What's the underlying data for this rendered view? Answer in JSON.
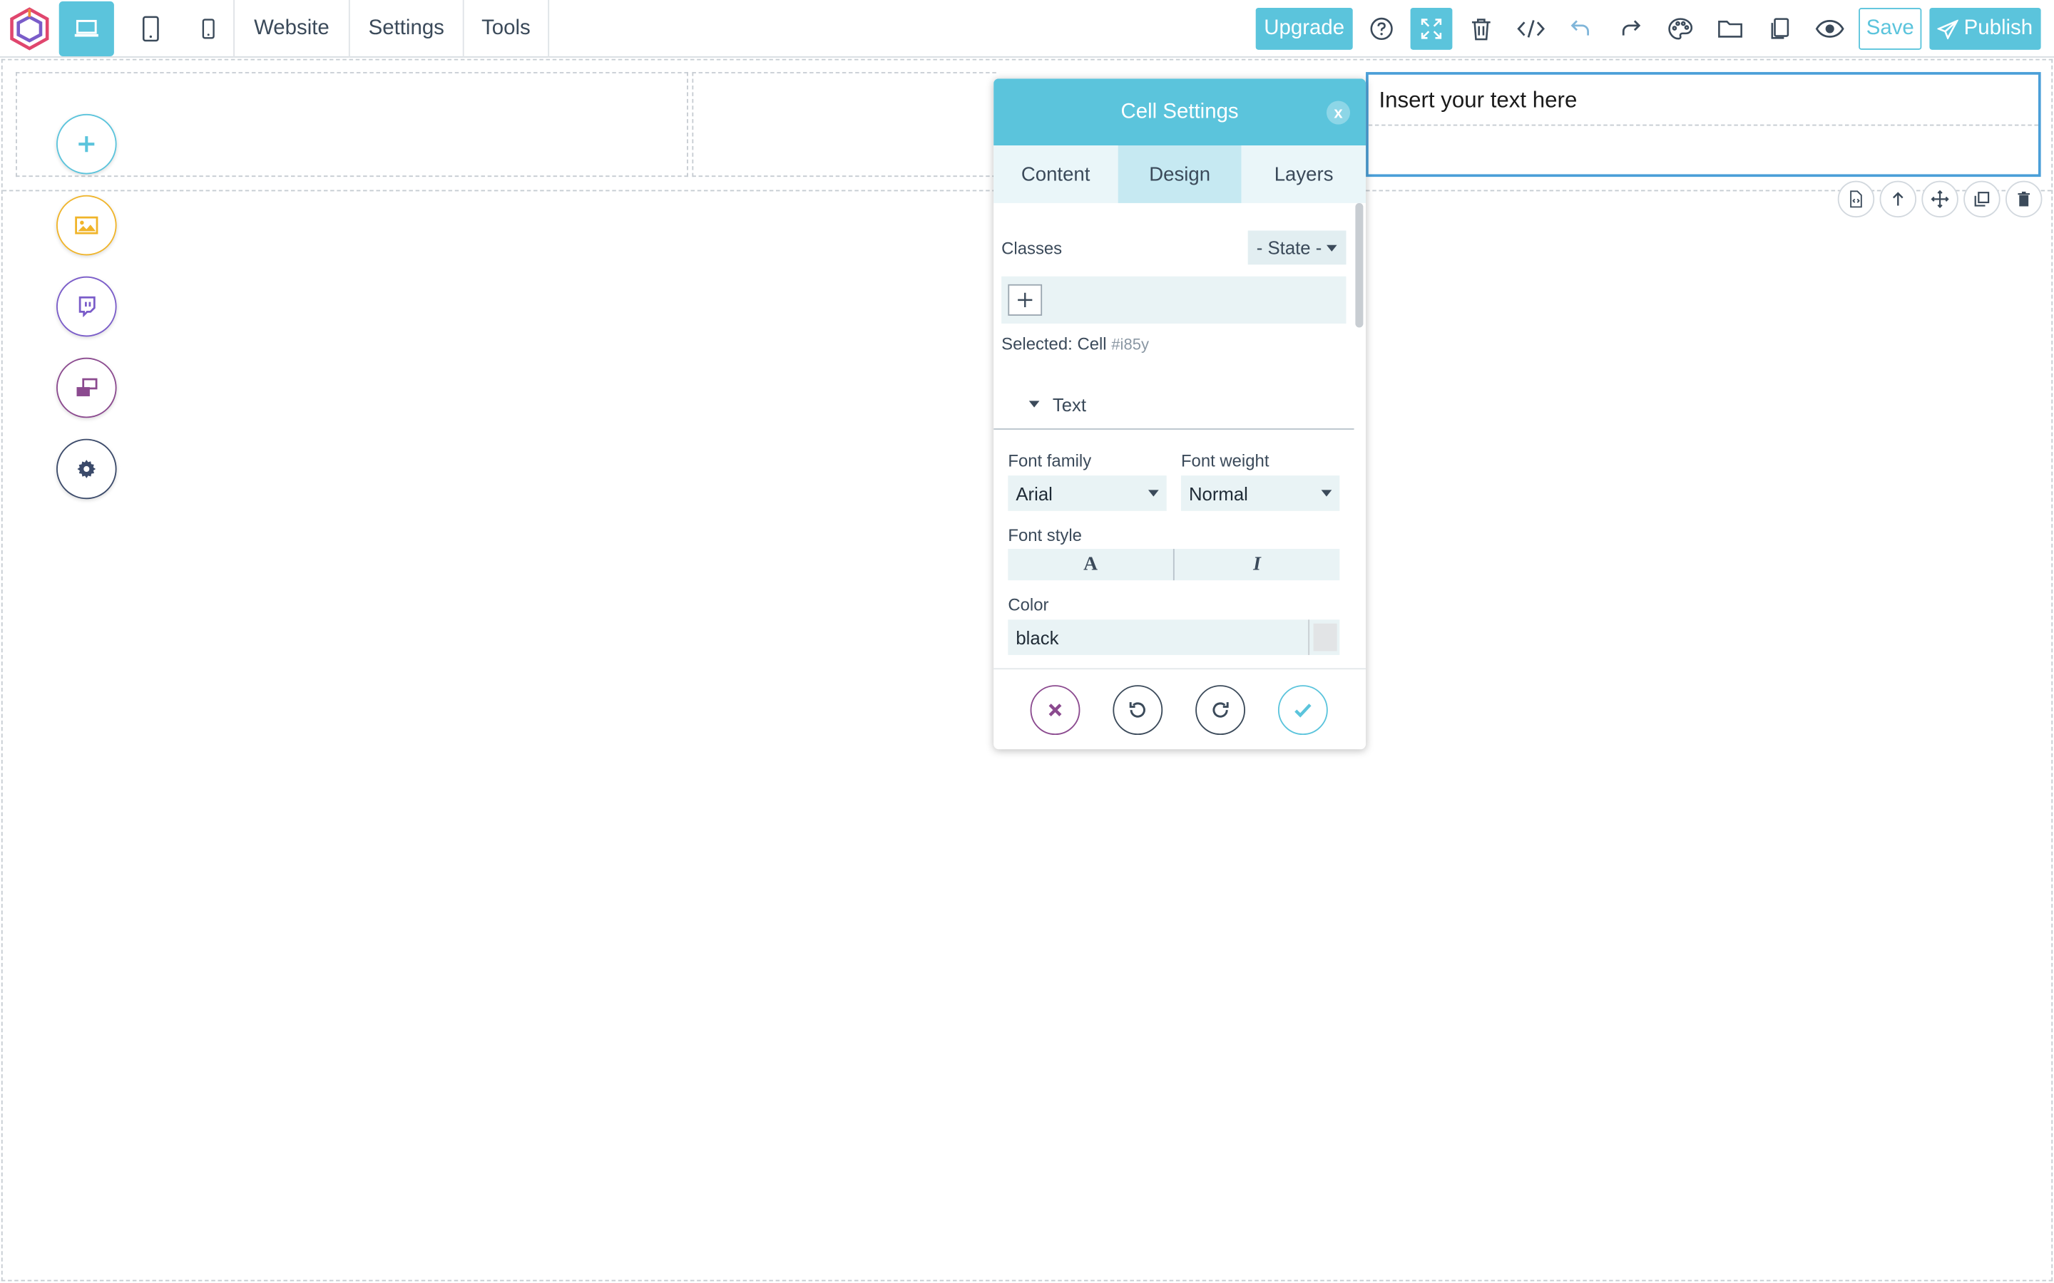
{
  "toolbar": {
    "menu": [
      "Website",
      "Settings",
      "Tools"
    ],
    "upgrade_label": "Upgrade",
    "save_label": "Save",
    "publish_label": "Publish"
  },
  "canvas": {
    "text_cell_content": "Insert your text here"
  },
  "panel": {
    "title": "Cell Settings",
    "close_label": "x",
    "tabs": [
      "Content",
      "Design",
      "Layers"
    ],
    "active_tab": "Design",
    "classes_label": "Classes",
    "state_label": "- State -",
    "selected_label": "Selected:",
    "selected_name": "Cell",
    "selected_id": "#i85y",
    "sector_title": "Text",
    "font_family_label": "Font family",
    "font_family_value": "Arial",
    "font_weight_label": "Font weight",
    "font_weight_value": "Normal",
    "font_style_label": "Font style",
    "font_style_options": [
      "A",
      "I"
    ],
    "color_label": "Color",
    "color_value": "black"
  },
  "colors": {
    "accent": "#5bc4dc",
    "fab_add": "#5bc4dc",
    "fab_image": "#f0b429",
    "fab_twitch": "#7a5cc9",
    "fab_blocks": "#8b4a8f",
    "fab_settings": "#3b4a6a"
  }
}
